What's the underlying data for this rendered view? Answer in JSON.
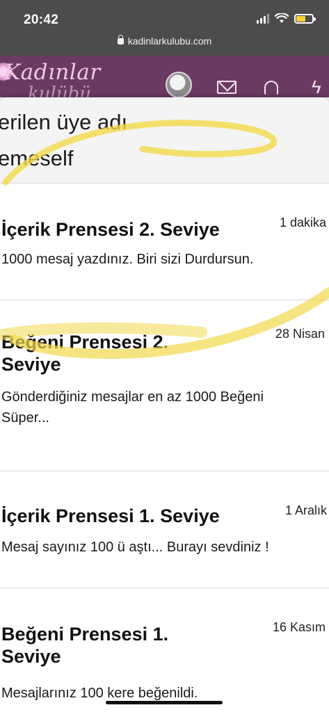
{
  "status_bar": {
    "time": "20:42",
    "url": "kadinlarkulubu.com"
  },
  "site": {
    "logo_line1": "Kadınlar",
    "logo_line2": "kulübü"
  },
  "popup": {
    "header_line1": "erilen üye adı",
    "header_line2": "emeself"
  },
  "alerts": [
    {
      "title": "İçerik Prensesi 2. Seviye",
      "time": "1 dakika",
      "text": "1000 mesaj yazdınız. Biri sizi Durdursun."
    },
    {
      "title": "Beğeni Prensesi 2. Seviye",
      "time": "28 Nisan",
      "text": "Gönderdiğiniz mesajlar en az 1000 Beğeni",
      "text2": "Süper..."
    },
    {
      "title": "İçerik Prensesi 1. Seviye",
      "time": "1 Aralık",
      "text": "Mesaj sayınız 100 ü aştı... Burayı sevdiniz !"
    },
    {
      "title": "Beğeni Prensesi 1. Seviye",
      "time": "16 Kasım",
      "text": "Mesajlarınız 100 kere beğenildi."
    }
  ],
  "colors": {
    "header_bg": "#6b3a63",
    "status_bg": "#4c4c4c",
    "highlight": "#f2d94a"
  },
  "icons": [
    "lock-icon",
    "signal-icon",
    "wifi-icon",
    "battery-icon",
    "mail-icon",
    "bell-icon",
    "lightning-icon"
  ]
}
